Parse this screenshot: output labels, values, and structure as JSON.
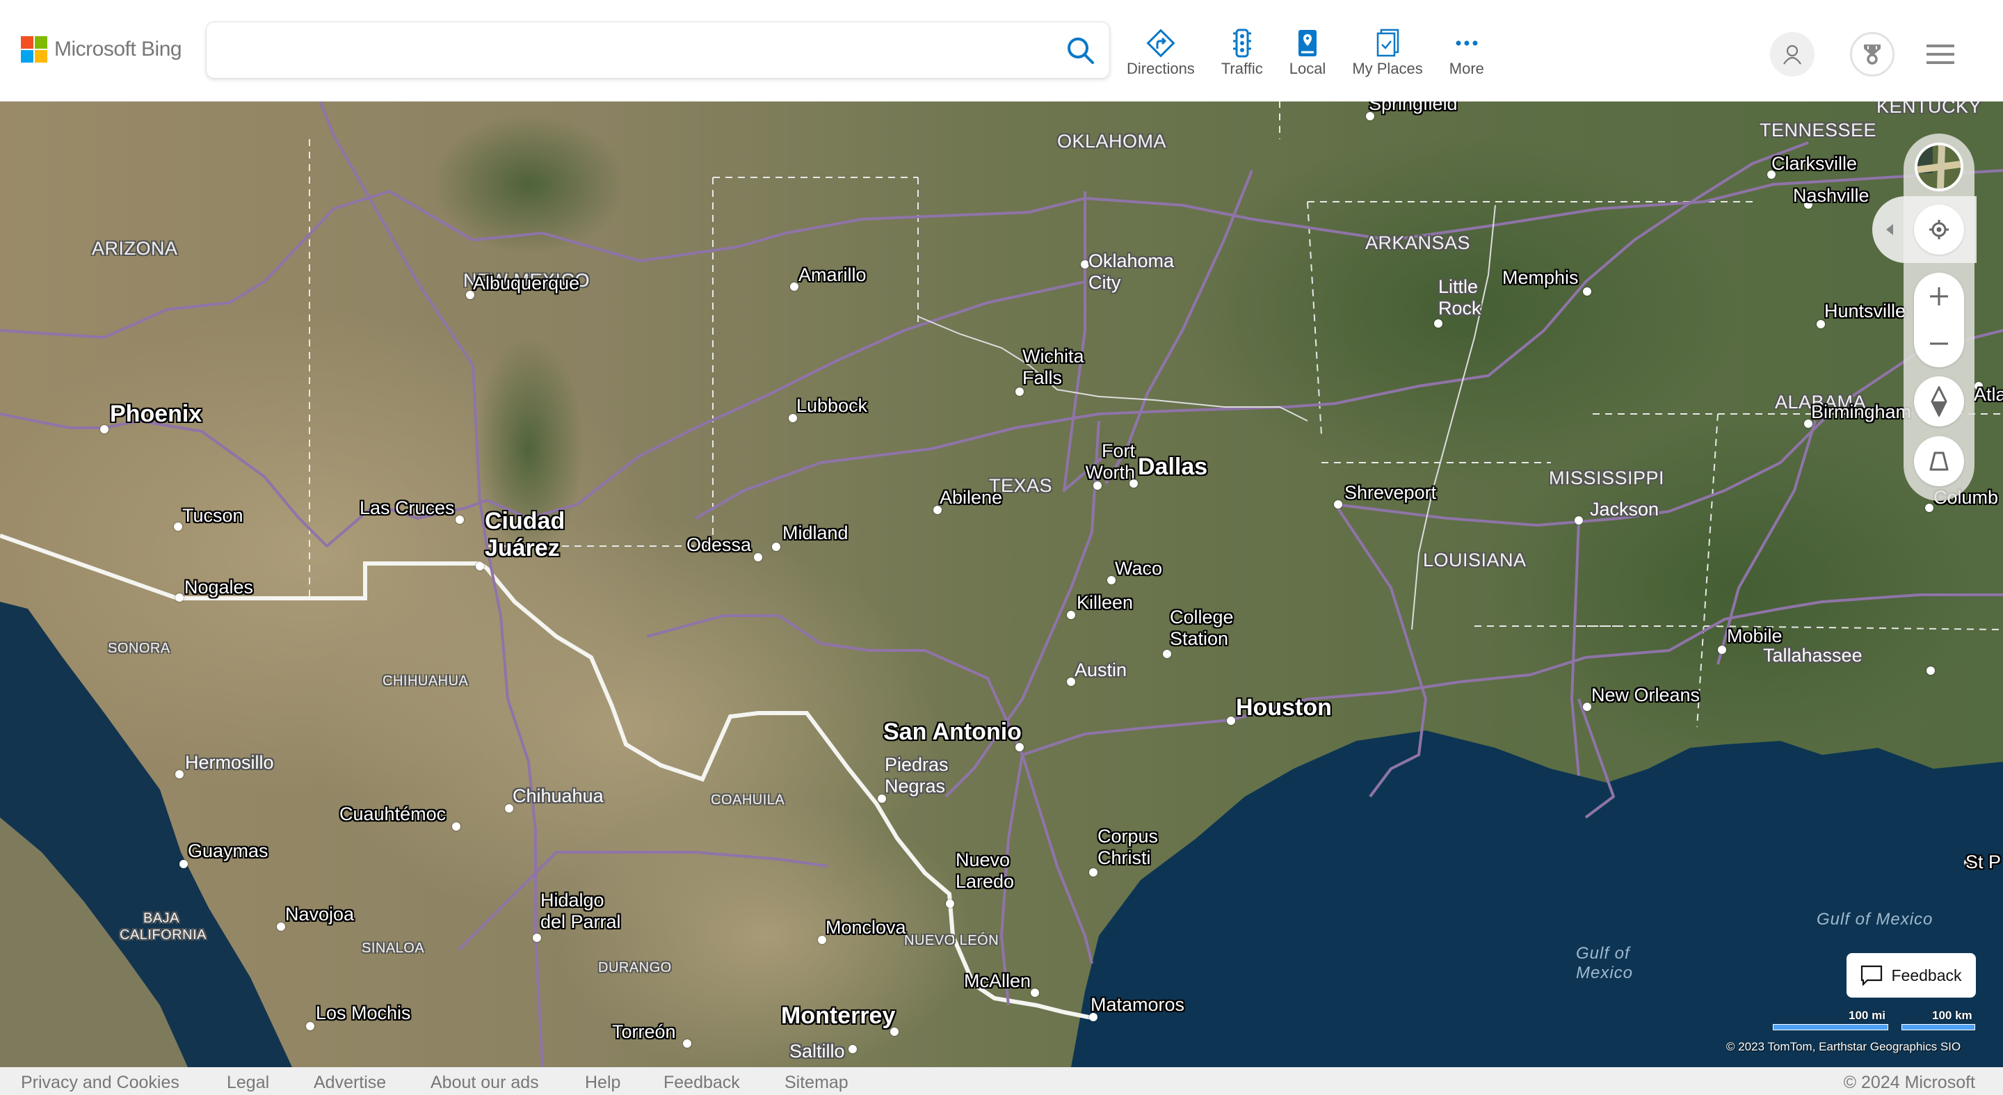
{
  "header": {
    "brand": "Microsoft Bing",
    "search": {
      "value": "",
      "placeholder": ""
    },
    "nav": [
      {
        "label": "Directions",
        "icon": "directions-icon"
      },
      {
        "label": "Traffic",
        "icon": "traffic-icon"
      },
      {
        "label": "Local",
        "icon": "local-icon"
      },
      {
        "label": "My Places",
        "icon": "my-places-icon"
      },
      {
        "label": "More",
        "icon": "more-icon"
      }
    ],
    "accent_color": "#0a78c8"
  },
  "map": {
    "state_labels": [
      "KENTUCKY",
      "OKLAHOMA",
      "ARIZONA",
      "NEW MEXICO",
      "ARKANSAS",
      "TENNESSEE",
      "TEXAS",
      "MISSISSIPPI",
      "ALABAMA",
      "LOUISIANA",
      "SONORA",
      "CHIHUAHUA",
      "COAHUILA",
      "NUEVO LEÓN",
      "BAJA CALIFORNIA",
      "SINALOA",
      "DURANGO"
    ],
    "cities": [
      "Springfield",
      "Clarksville",
      "Nashville",
      "Oklahoma City",
      "Albuquerque",
      "Amarillo",
      "Memphis",
      "Little Rock",
      "Huntsville",
      "Wichita Falls",
      "Phoenix",
      "Lubbock",
      "Birmingham",
      "Atla",
      "Fort Worth",
      "Dallas",
      "Abilene",
      "Shreveport",
      "Jackson",
      "Columb",
      "Tucson",
      "Las Cruces",
      "Ciudad Juárez",
      "Odessa",
      "Midland",
      "Nogales",
      "Waco",
      "Killeen",
      "College Station",
      "Mobile",
      "Tallahassee",
      "Austin",
      "New Orleans",
      "Houston",
      "San Antonio",
      "Hermosillo",
      "Piedras Negras",
      "Chihuahua",
      "Cuauhtémoc",
      "Corpus Christi",
      "Guaymas",
      "Nuevo Laredo",
      "St P",
      "Navojoa",
      "Hidalgo del Parral",
      "Monclova",
      "McAllen",
      "Matamoros",
      "Los Mochis",
      "Monterrey",
      "Torreón",
      "Saltillo"
    ],
    "water_labels": [
      "Gulf of Mexico",
      "Gulf of Mexico"
    ]
  },
  "controls": {
    "style_switcher": "aerial",
    "locate": "locate-me",
    "zoom_in": "+",
    "zoom_out": "−",
    "feedback_label": "Feedback",
    "scale_mi": "100 mi",
    "scale_km": "100 km",
    "attribution": "© 2023 TomTom, Earthstar Geographics SIO"
  },
  "footer": {
    "links": [
      "Privacy and Cookies",
      "Legal",
      "Advertise",
      "About our ads",
      "Help",
      "Feedback",
      "Sitemap"
    ],
    "copyright": "© 2024 Microsoft"
  }
}
